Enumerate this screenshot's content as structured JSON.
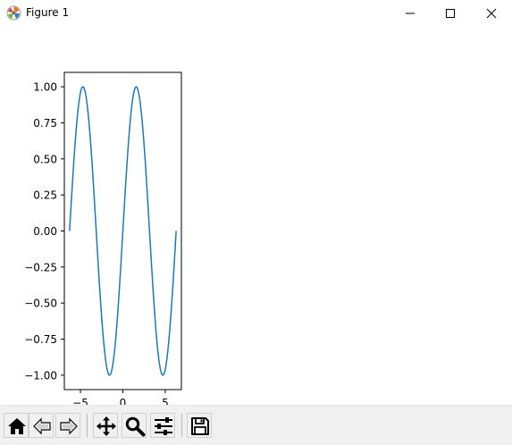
{
  "window": {
    "title": "Figure 1",
    "app_icon": "matplotlib-icon",
    "controls": [
      "minimize-icon",
      "maximize-icon",
      "close-icon"
    ]
  },
  "chart_data": {
    "type": "line",
    "function": "sin(x)",
    "title": "",
    "xlabel": "",
    "ylabel": "",
    "xlim": [
      -6.9,
      6.9
    ],
    "ylim": [
      -1.1,
      1.1
    ],
    "xticks": [
      -5,
      0,
      5
    ],
    "xtick_labels": [
      "−5",
      "0",
      "5"
    ],
    "yticks": [
      1.0,
      0.75,
      0.5,
      0.25,
      0.0,
      -0.25,
      -0.5,
      -0.75,
      -1.0
    ],
    "ytick_labels": [
      "1.00",
      "0.75",
      "0.50",
      "0.25",
      "0.00",
      "−0.25",
      "−0.50",
      "−0.75",
      "−1.00"
    ],
    "series": [
      {
        "color": "#1f77b4",
        "x_range": [
          -6.2832,
          6.2832
        ],
        "samples": 200
      }
    ],
    "grid": false
  },
  "toolbar": {
    "buttons": [
      {
        "name": "home-button",
        "icon": "home-icon"
      },
      {
        "name": "back-button",
        "icon": "back-arrow-icon"
      },
      {
        "name": "forward-button",
        "icon": "forward-arrow-icon"
      },
      {
        "name": "pan-button",
        "icon": "move-icon"
      },
      {
        "name": "zoom-button",
        "icon": "magnifier-icon"
      },
      {
        "name": "subplots-button",
        "icon": "sliders-icon"
      },
      {
        "name": "save-button",
        "icon": "floppy-disk-icon"
      }
    ]
  }
}
